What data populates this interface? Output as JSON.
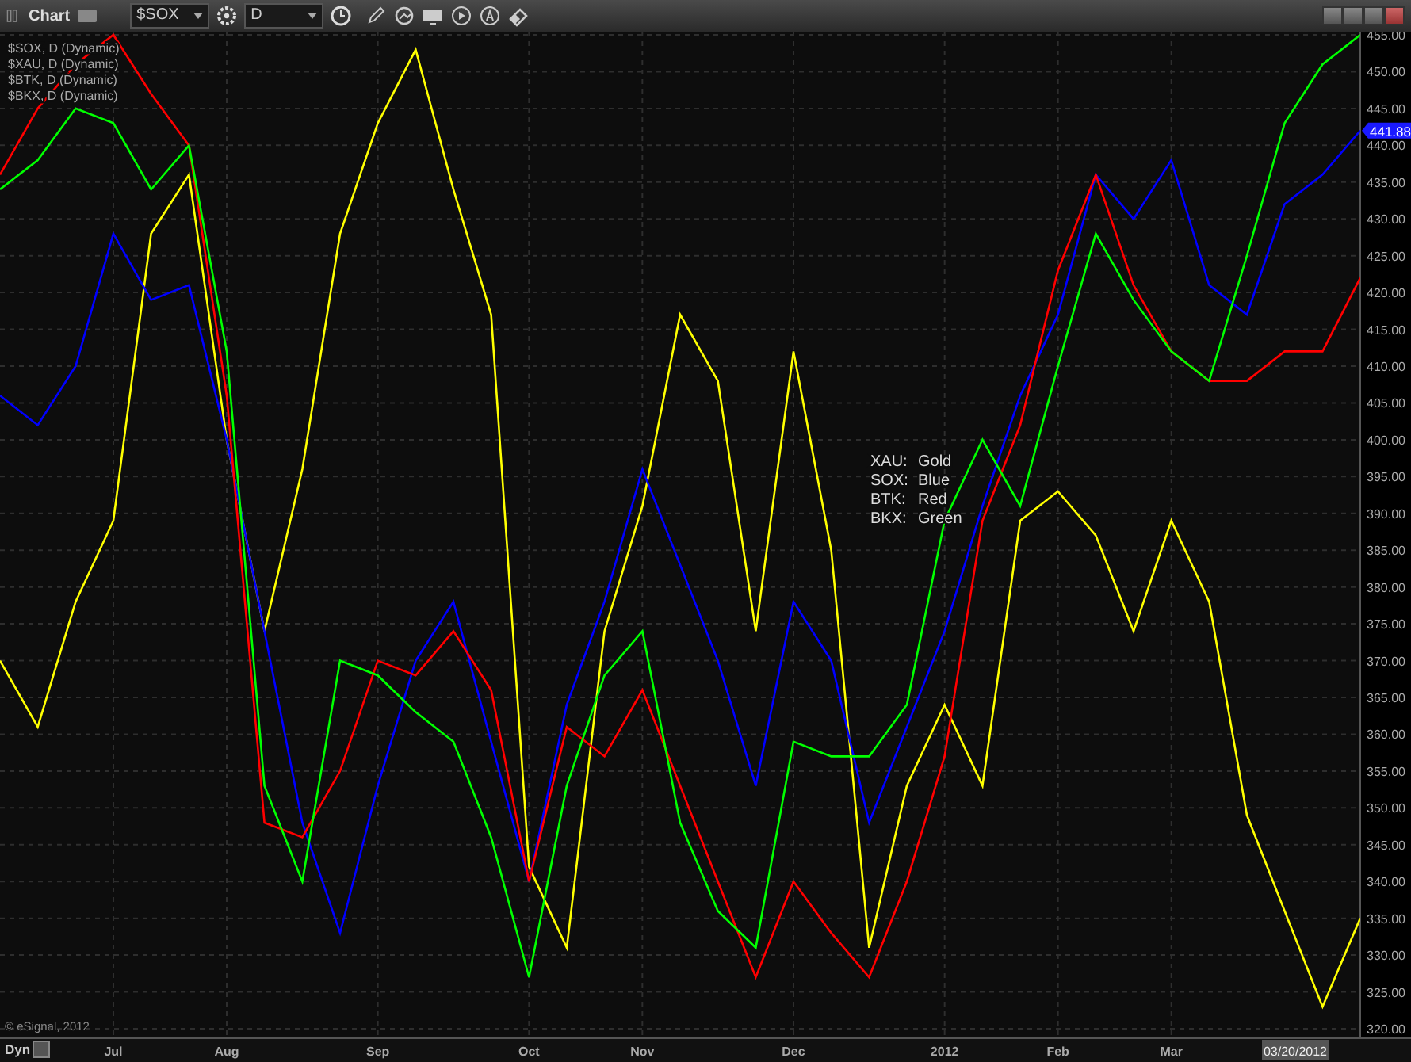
{
  "toolbar": {
    "title": "Chart",
    "symbol": "$SOX",
    "interval": "D"
  },
  "legend": [
    "$SOX, D (Dynamic)",
    "$XAU, D (Dynamic)",
    "$BTK, D (Dynamic)",
    "$BKX, D (Dynamic)"
  ],
  "annotation": [
    {
      "name": "XAU:",
      "value": "Gold"
    },
    {
      "name": "SOX:",
      "value": "Blue"
    },
    {
      "name": "BTK:",
      "value": "Red"
    },
    {
      "name": "BKX:",
      "value": "Green"
    }
  ],
  "price_tag": "441.88",
  "copyright": "© eSignal, 2012",
  "scale_mode": "Dyn",
  "cursor_date": "03/20/2012",
  "chart_data": {
    "type": "line",
    "categories": [
      null,
      null,
      null,
      "Jul",
      null,
      null,
      "Aug",
      null,
      null,
      null,
      "Sep",
      null,
      null,
      null,
      "Oct",
      null,
      null,
      "Nov",
      null,
      null,
      null,
      "Dec",
      null,
      null,
      null,
      "2012",
      null,
      null,
      "Feb",
      null,
      null,
      "Mar",
      null,
      null,
      null,
      null,
      null
    ],
    "series": [
      {
        "color": "#ffff00",
        "values": [
          370,
          361,
          378,
          389,
          428,
          436,
          400,
          374,
          396,
          428,
          443,
          453,
          434,
          417,
          342,
          331,
          374,
          391,
          417,
          408,
          374,
          412,
          385,
          331,
          353,
          364,
          353,
          389,
          393,
          387,
          374,
          389,
          378,
          349,
          336,
          323,
          335
        ]
      },
      {
        "color": "#0000ff",
        "values": [
          406,
          402,
          410,
          428,
          419,
          421,
          400,
          374,
          348,
          333,
          353,
          370,
          378,
          359,
          340,
          364,
          378,
          396,
          383,
          370,
          353,
          378,
          370,
          348,
          361,
          374,
          391,
          406,
          417,
          436,
          430,
          438,
          421,
          417,
          432,
          436,
          442
        ]
      },
      {
        "color": "#ff0000",
        "values": [
          436,
          445,
          451,
          455,
          447,
          440,
          406,
          348,
          346,
          355,
          370,
          368,
          374,
          366,
          340,
          361,
          357,
          366,
          353,
          340,
          327,
          340,
          333,
          327,
          340,
          357,
          389,
          402,
          423,
          436,
          421,
          412,
          408,
          408,
          412,
          412,
          422
        ]
      },
      {
        "color": "#00ff00",
        "values": [
          434,
          438,
          445,
          443,
          434,
          440,
          412,
          353,
          340,
          370,
          368,
          363,
          359,
          346,
          327,
          353,
          368,
          374,
          348,
          336,
          331,
          359,
          357,
          357,
          364,
          389,
          400,
          391,
          410,
          428,
          419,
          412,
          408,
          425,
          443,
          451,
          455
        ]
      }
    ],
    "ylim": [
      320,
      455
    ],
    "grid": true,
    "yticks": [
      {
        "value": 320,
        "label": "320.00"
      },
      {
        "value": 325,
        "label": "325.00"
      },
      {
        "value": 330,
        "label": "330.00"
      },
      {
        "value": 335,
        "label": "335.00"
      },
      {
        "value": 340,
        "label": "340.00"
      },
      {
        "value": 345,
        "label": "345.00"
      },
      {
        "value": 350,
        "label": "350.00"
      },
      {
        "value": 355,
        "label": "355.00"
      },
      {
        "value": 360,
        "label": "360.00"
      },
      {
        "value": 365,
        "label": "365.00"
      },
      {
        "value": 370,
        "label": "370.00"
      },
      {
        "value": 375,
        "label": "375.00"
      },
      {
        "value": 380,
        "label": "380.00"
      },
      {
        "value": 385,
        "label": "385.00"
      },
      {
        "value": 390,
        "label": "390.00"
      },
      {
        "value": 395,
        "label": "395.00"
      },
      {
        "value": 400,
        "label": "400.00"
      },
      {
        "value": 405,
        "label": "405.00"
      },
      {
        "value": 410,
        "label": "410.00"
      },
      {
        "value": 415,
        "label": "415.00"
      },
      {
        "value": 420,
        "label": "420.00"
      },
      {
        "value": 425,
        "label": "425.00"
      },
      {
        "value": 430,
        "label": "430.00"
      },
      {
        "value": 435,
        "label": "435.00"
      },
      {
        "value": 440,
        "label": "440.00"
      },
      {
        "value": 445,
        "label": "445.00"
      },
      {
        "value": 450,
        "label": "450.00"
      },
      {
        "value": 455,
        "label": "455.00"
      }
    ]
  }
}
